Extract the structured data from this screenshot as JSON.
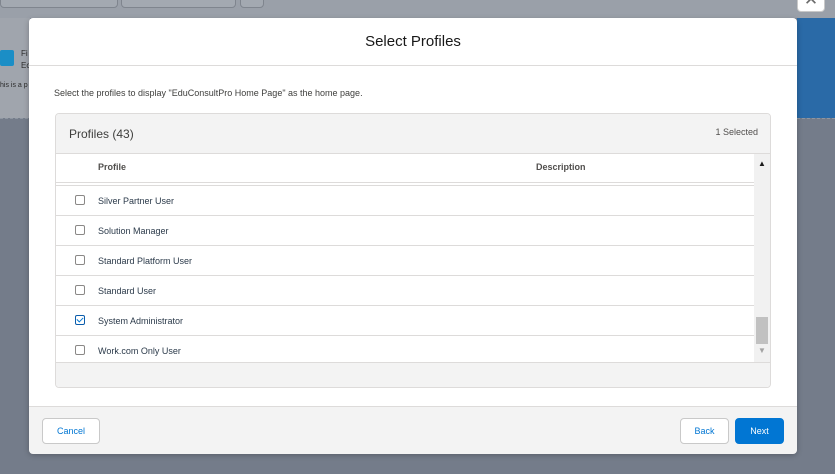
{
  "background": {
    "snippet_1": "Fi",
    "snippet_2": "Ec",
    "snippet_3": "his is a p"
  },
  "icons": {
    "close": "close-icon",
    "check": "check-icon",
    "scroll_up": "chevron-up-icon",
    "scroll_down": "chevron-down-icon"
  },
  "modal": {
    "title": "Select Profiles",
    "instruction": "Select the profiles to display \"EduConsultPro Home Page\" as the home page."
  },
  "profiles": {
    "title": "Profiles (43)",
    "selected_count": "1 Selected",
    "columns": {
      "profile": "Profile",
      "description": "Description"
    },
    "rows": [
      {
        "name": "Silver Partner User",
        "description": "",
        "checked": false
      },
      {
        "name": "Solution Manager",
        "description": "",
        "checked": false
      },
      {
        "name": "Standard Platform User",
        "description": "",
        "checked": false
      },
      {
        "name": "Standard User",
        "description": "",
        "checked": false
      },
      {
        "name": "System Administrator",
        "description": "",
        "checked": true
      },
      {
        "name": "Work.com Only User",
        "description": "",
        "checked": false
      }
    ]
  },
  "footer": {
    "cancel": "Cancel",
    "back": "Back",
    "next": "Next"
  },
  "colors": {
    "brand": "#0176d3",
    "overlay": "#7b8493",
    "header_bg": "#f3f3f3"
  }
}
